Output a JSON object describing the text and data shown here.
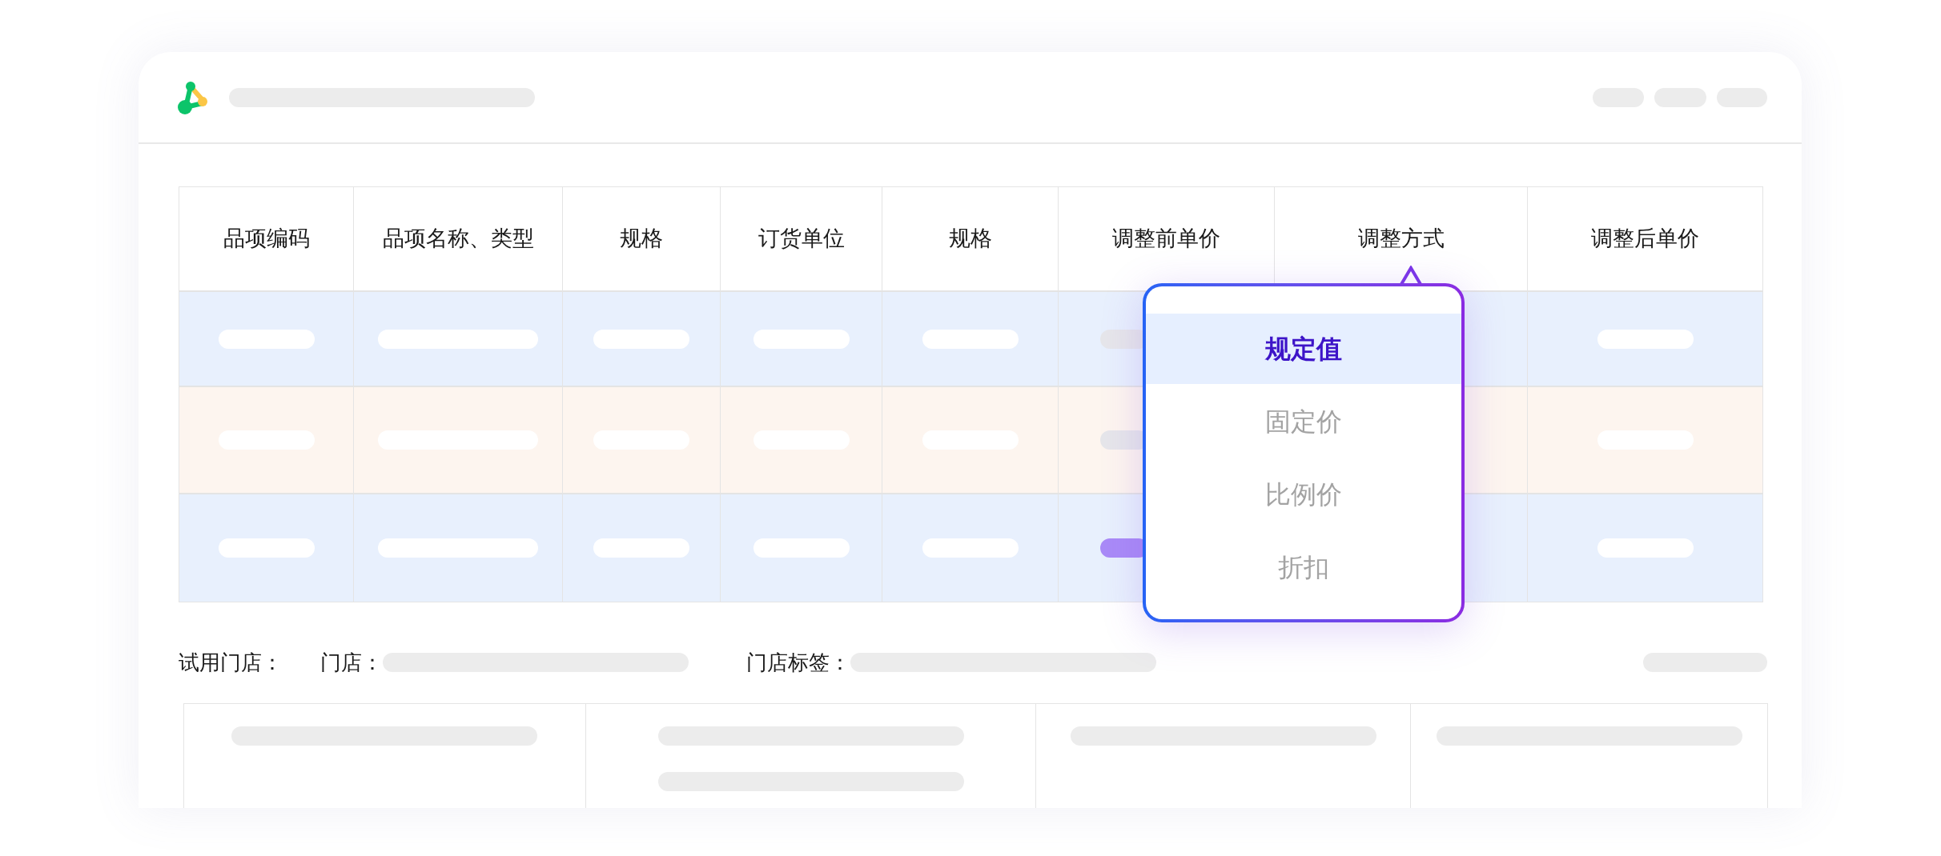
{
  "table": {
    "columns": [
      "品项编码",
      "品项名称、类型",
      "规格",
      "订货单位",
      "规格",
      "调整前单价",
      "调整方式",
      "调整后单价"
    ],
    "rows": [
      {
        "color": "#e8f0fd",
        "highlight": false
      },
      {
        "color": "#fdf5ef",
        "highlight": false
      },
      {
        "color": "#e8f0fd",
        "highlight": true
      }
    ]
  },
  "dropdown": {
    "items": [
      {
        "label": "规定值",
        "selected": true
      },
      {
        "label": "固定价",
        "selected": false
      },
      {
        "label": "比例价",
        "selected": false
      },
      {
        "label": "折扣",
        "selected": false
      }
    ]
  },
  "filters": {
    "label": "试用门店：",
    "fields": [
      {
        "label": "门店："
      },
      {
        "label": "门店标签："
      }
    ]
  }
}
